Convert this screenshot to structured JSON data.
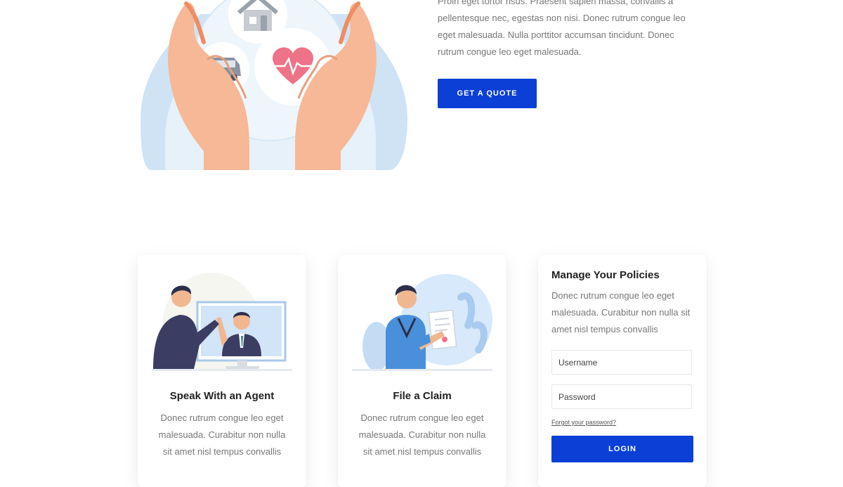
{
  "hero": {
    "body_lines": [
      "Proin eget tortor risus. Praesent sapien massa, convallis a",
      "pellentesque nec, egestas non nisi. Donec rutrum congue leo",
      "eget malesuada. Nulla porttitor accumsan tincidunt. Donec",
      "rutrum congue leo eget malesuada."
    ],
    "cta_label": "GET A QUOTE",
    "illustration_icons": [
      "house-icon",
      "car-icon",
      "heart-icon"
    ]
  },
  "cards": [
    {
      "title": "Speak With an Agent",
      "body": "Donec rutrum congue leo eget malesuada. Curabitur non nulla sit amet nisl tempus convallis"
    },
    {
      "title": "File a Claim",
      "body": "Donec rutrum congue leo eget malesuada. Curabitur non nulla sit amet nisl tempus convallis"
    }
  ],
  "login": {
    "title": "Manage Your Policies",
    "body": "Donec rutrum congue leo eget malesuada. Curabitur non nulla sit amet nisl tempus convallis",
    "username_placeholder": "Username",
    "password_placeholder": "Password",
    "forgot_label": "Forgot your password?",
    "button_label": "LOGIN"
  },
  "colors": {
    "accent": "#0b3fd6"
  }
}
